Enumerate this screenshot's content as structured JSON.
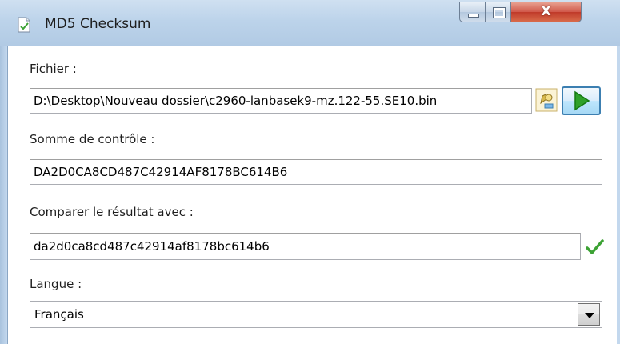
{
  "window": {
    "title": "MD5 Checksum",
    "close_glyph": "X"
  },
  "file": {
    "label": "Fichier :",
    "value": "D:\\Desktop\\Nouveau dossier\\c2960-lanbasek9-mz.122-55.SE10.bin"
  },
  "checksum": {
    "label": "Somme de contrôle :",
    "value": "DA2D0CA8CD487C42914AF8178BC614B6"
  },
  "compare": {
    "label": "Comparer le résultat avec :",
    "value": "da2d0ca8cd487c42914af8178bc614b6",
    "match_icon": "green-check-icon"
  },
  "language": {
    "label": "Langue :",
    "selected": "Français"
  },
  "colors": {
    "accent_green": "#3ca234",
    "titlebar": "#bcd3ea",
    "close_red": "#c8463a"
  }
}
